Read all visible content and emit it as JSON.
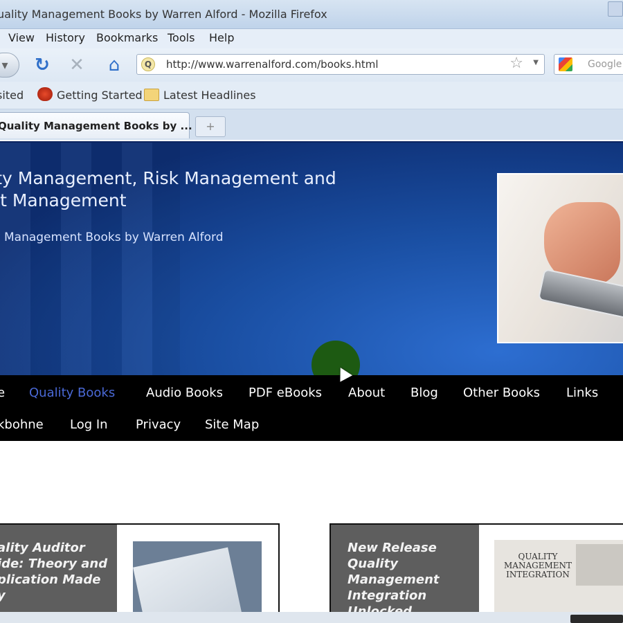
{
  "window": {
    "title": "uality Management Books by Warren Alford - Mozilla Firefox"
  },
  "menu": {
    "view": "View",
    "history": "History",
    "bookmarks": "Bookmarks",
    "tools": "Tools",
    "help": "Help"
  },
  "toolbar": {
    "url": "http://www.warrenalford.com/books.html",
    "site_icon_letter": "Q",
    "search_placeholder": "Google"
  },
  "bookmarks_bar": {
    "items": [
      "Visited",
      "Getting Started",
      "Latest Headlines"
    ]
  },
  "tabs": {
    "active_label": "Quality Management Books by ...",
    "new_tab": "+"
  },
  "hero": {
    "title_line1": "ality Management, Risk Management and",
    "title_line2": "ject Management",
    "subtitle": "ality Management Books by Warren Alford"
  },
  "site_nav": {
    "row1": [
      "e",
      "Quality Books",
      "Audio Books",
      "PDF eBooks",
      "About",
      "Blog",
      "Other Books",
      "Links"
    ],
    "row2": [
      "kbohne",
      "Log In",
      "Privacy",
      "Site Map"
    ],
    "active": "Quality Books"
  },
  "cards": [
    {
      "label_lines": [
        "ality Auditor",
        "ide: Theory and",
        "plication Made",
        "y"
      ]
    },
    {
      "label_lines": [
        "New Release",
        "Quality",
        "Management",
        "Integration",
        "Unlocked"
      ],
      "cover_text": "QUALITY MANAGEMENT INTEGRATION"
    }
  ],
  "colors": {
    "hero_blue": "#1a4fa3",
    "nav_bg": "#000000",
    "nav_active": "#4a69d6",
    "card_label_bg": "#5e5e5e"
  }
}
